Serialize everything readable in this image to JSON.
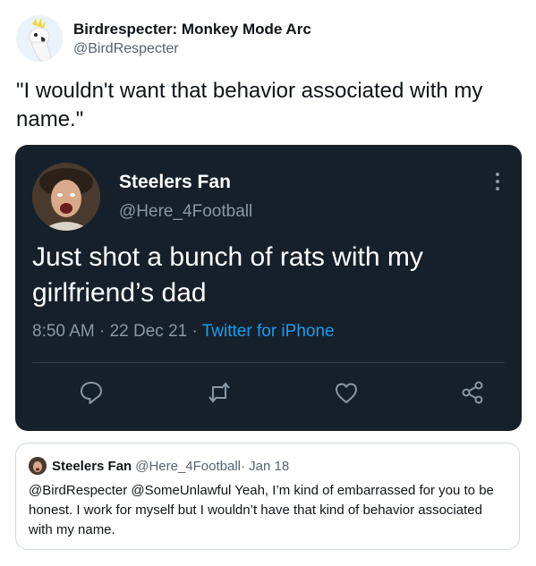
{
  "author": {
    "display_name": "Birdrespecter: Monkey Mode Arc",
    "handle": "@BirdRespecter"
  },
  "tweet_text": "\"I wouldn't want that behavior associated with my name.\"",
  "quoted": {
    "display_name": "Steelers Fan",
    "handle": "@Here_4Football",
    "text": "Just shot a bunch of rats with my girlfriend’s dad",
    "time": "8:50 AM · 22 Dec 21 · ",
    "source": "Twitter for iPhone"
  },
  "reply": {
    "display_name": "Steelers Fan",
    "meta": "@Here_4Football· Jan 18",
    "text": "@BirdRespecter @SomeUnlawful Yeah, I’m kind of embarrassed for you to be honest. I work for myself but I wouldn’t have that kind of behavior associated with my name."
  },
  "icons": [
    "more-icon",
    "reply-icon",
    "retweet-icon",
    "like-icon",
    "share-icon"
  ],
  "colors": {
    "card_bg": "#15202b",
    "link": "#1d9bf0",
    "muted": "#8b98a5"
  }
}
